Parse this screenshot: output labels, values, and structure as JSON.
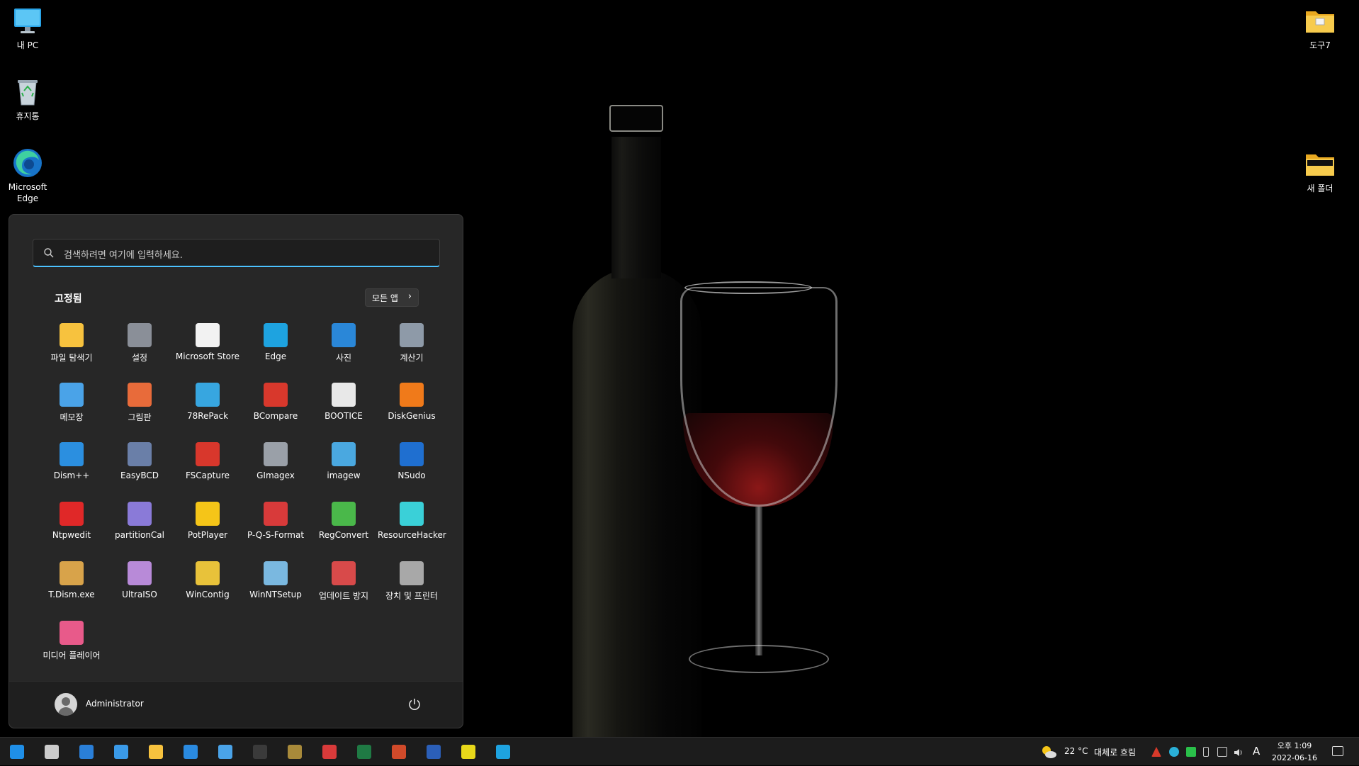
{
  "desktop": {
    "icons_left": [
      {
        "label": "내 PC",
        "icon": "this-pc-icon"
      },
      {
        "label": "휴지통",
        "icon": "recycle-bin-icon"
      },
      {
        "label": "Microsoft Edge",
        "icon": "edge-icon"
      }
    ],
    "icons_right": [
      {
        "label": "도구7",
        "icon": "folder-icon"
      },
      {
        "label": "새 폴더",
        "icon": "folder-icon"
      }
    ]
  },
  "start_menu": {
    "search_placeholder": "검색하려면 여기에 입력하세요.",
    "pinned_title": "고정됨",
    "all_apps_label": "모든 앱",
    "apps": [
      {
        "label": "파일 탐색기",
        "icon": "file-explorer-icon",
        "color": "#f7c23e"
      },
      {
        "label": "설정",
        "icon": "settings-gear-icon",
        "color": "#8a8f98"
      },
      {
        "label": "Microsoft Store",
        "icon": "store-icon",
        "color": "#f2f2f2"
      },
      {
        "label": "Edge",
        "icon": "edge-icon",
        "color": "#1ea3e0"
      },
      {
        "label": "사진",
        "icon": "photos-icon",
        "color": "#2a87d8"
      },
      {
        "label": "계산기",
        "icon": "calculator-icon",
        "color": "#8e9aa8"
      },
      {
        "label": "메모장",
        "icon": "notepad-icon",
        "color": "#4aa3e8"
      },
      {
        "label": "그림판",
        "icon": "paint-icon",
        "color": "#e86b3a"
      },
      {
        "label": "78RePack",
        "icon": "78repack-icon",
        "color": "#37a6e0"
      },
      {
        "label": "BCompare",
        "icon": "bcompare-icon",
        "color": "#d8382c"
      },
      {
        "label": "BOOTICE",
        "icon": "bootice-icon",
        "color": "#e8e8e8"
      },
      {
        "label": "DiskGenius",
        "icon": "diskgenius-icon",
        "color": "#f07a1a"
      },
      {
        "label": "Dism++",
        "icon": "dism-gears-icon",
        "color": "#2b8fe0"
      },
      {
        "label": "EasyBCD",
        "icon": "easybcd-icon",
        "color": "#6a7fa8"
      },
      {
        "label": "FSCapture",
        "icon": "fscapture-icon",
        "color": "#d8372c"
      },
      {
        "label": "GImagex",
        "icon": "gimagex-icon",
        "color": "#9aa0a8"
      },
      {
        "label": "imagew",
        "icon": "imagew-icon",
        "color": "#4aa8e0"
      },
      {
        "label": "NSudo",
        "icon": "nsudo-icon",
        "color": "#1f6fd0"
      },
      {
        "label": "Ntpwedit",
        "icon": "ntpwedit-icon",
        "color": "#e02828"
      },
      {
        "label": "partitionCal",
        "icon": "partitioncal-icon",
        "color": "#8a7ad8"
      },
      {
        "label": "PotPlayer",
        "icon": "potplayer-icon",
        "color": "#f5c518"
      },
      {
        "label": "P-Q-S-Format",
        "icon": "pqs-format-icon",
        "color": "#d83a3a"
      },
      {
        "label": "RegConvert",
        "icon": "regconvert-icon",
        "color": "#4ab84a"
      },
      {
        "label": "ResourceHacker",
        "icon": "resourcehacker-icon",
        "color": "#3ad0d8"
      },
      {
        "label": "T.Dism.exe",
        "icon": "tdism-icon",
        "color": "#d8a34a"
      },
      {
        "label": "UltraISO",
        "icon": "ultraiso-icon",
        "color": "#b88ad8"
      },
      {
        "label": "WinContig",
        "icon": "wincontig-icon",
        "color": "#e8c23a"
      },
      {
        "label": "WinNTSetup",
        "icon": "winntsetup-icon",
        "color": "#7ab8e0"
      },
      {
        "label": "업데이트 방지",
        "icon": "update-block-icon",
        "color": "#d84a4a"
      },
      {
        "label": "장치 및 프린터",
        "icon": "printer-icon",
        "color": "#a8a8a8"
      },
      {
        "label": "미디어 플레이어",
        "icon": "media-player-icon",
        "color": "#e85a8a"
      }
    ],
    "user_name": "Administrator"
  },
  "taskbar": {
    "apps": [
      {
        "name": "start-button",
        "icon": "windows-logo-icon",
        "color": "#1f8fe8"
      },
      {
        "name": "search-button",
        "icon": "search-icon",
        "color": "#cccccc"
      },
      {
        "name": "taskbar-app-1",
        "icon": "app-icon",
        "color": "#2a7fd8"
      },
      {
        "name": "taskbar-app-2",
        "icon": "control-panel-icon",
        "color": "#3a9ae8"
      },
      {
        "name": "taskbar-file-explorer",
        "icon": "file-explorer-icon",
        "color": "#f7c23e"
      },
      {
        "name": "taskbar-store",
        "icon": "store-icon",
        "color": "#2a8ae0"
      },
      {
        "name": "taskbar-notepad",
        "icon": "notepad-icon",
        "color": "#4aa3e8"
      },
      {
        "name": "taskbar-terminal",
        "icon": "terminal-icon",
        "color": "#3a3a3a"
      },
      {
        "name": "taskbar-app-8",
        "icon": "tool-icon",
        "color": "#a88a3a"
      },
      {
        "name": "taskbar-app-9",
        "icon": "pinwheel-icon",
        "color": "#d83a3a"
      },
      {
        "name": "taskbar-excel",
        "icon": "excel-icon",
        "color": "#1f7a44"
      },
      {
        "name": "taskbar-powerpoint",
        "icon": "powerpoint-icon",
        "color": "#d04a2a"
      },
      {
        "name": "taskbar-word",
        "icon": "word-icon",
        "color": "#2b5fb8"
      },
      {
        "name": "taskbar-app-13",
        "icon": "app-icon",
        "color": "#e8d81a"
      },
      {
        "name": "taskbar-edge",
        "icon": "edge-icon",
        "color": "#1ea3e0"
      }
    ],
    "weather": {
      "temp": "22 °C",
      "desc": "대체로 흐림",
      "icon": "partly-cloudy-icon"
    },
    "ime": "A",
    "time": "오후 1:09",
    "date": "2022-06-16"
  },
  "colors": {
    "accent": "#4cc2ff",
    "menu_bg": "#272727",
    "taskbar_bg": "#1c1c1c"
  }
}
